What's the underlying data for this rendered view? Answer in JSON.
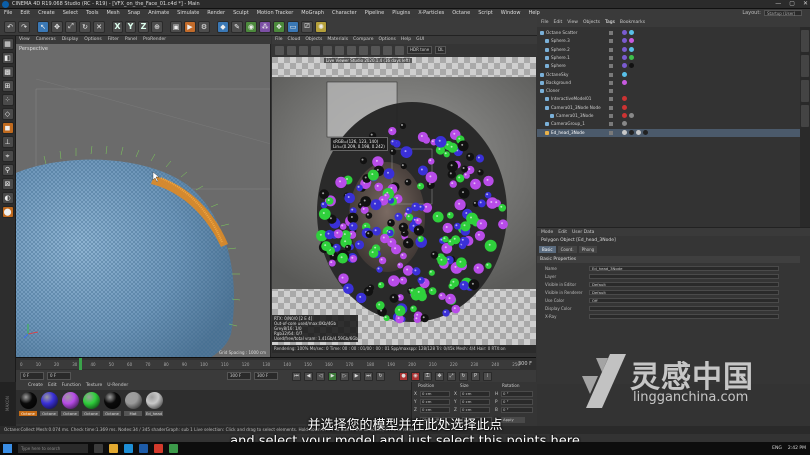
{
  "window": {
    "title": "CINEMA 4D R19.068 Studio (RC - R19) - [VFX_on_the_Face_01.c4d *] - Main",
    "controls": [
      "—",
      "▢",
      "✕"
    ]
  },
  "menubar": [
    "File",
    "Edit",
    "Create",
    "Select",
    "Tools",
    "Mesh",
    "Snap",
    "Animate",
    "Simulate",
    "Render",
    "Sculpt",
    "Motion Tracker",
    "MoGraph",
    "Character",
    "Pipeline",
    "Plugins",
    "X-Particles",
    "Octane",
    "Script",
    "Window",
    "Help"
  ],
  "layout": {
    "label": "Layout:",
    "value": "Startup (User)"
  },
  "toolbar": {
    "axis_labels": [
      "X",
      "Y",
      "Z"
    ]
  },
  "viewport": {
    "menu": [
      "View",
      "Cameras",
      "Display",
      "Options",
      "Filter",
      "Panel",
      "ProRender"
    ],
    "label": "Perspective",
    "grid_spacing": "Grid Spacing : 1000 cm"
  },
  "render_window": {
    "menu": [
      "File",
      "Cloud",
      "Objects",
      "Materials",
      "Compare",
      "Options",
      "Help",
      "GUI"
    ],
    "title": "Live Viewer Studio 2020.1.4 (16 days left)",
    "tonemap": "HDR tone",
    "zoom": "DL",
    "pixel_info": [
      "sRGB=(126, 123, 140)",
      "Lin=(0.209, 0.198, 0.242)"
    ],
    "stats": [
      "RTX: 0/N0/0 [2 E 4]",
      "Out-of-core used/max:0Kb/4Gb",
      "Grey8/16: 1/0",
      "Rgb32/64: 0/7",
      "Used/free/total vram: 1.41Gb/4.59Gb/6Gb"
    ],
    "status": "Rendering: 100%   Ms/sec: 0   Time: 00 : 00 : 01/00 : 00 : 01   Spp/maxspp: 128/128   Tri: 0/45k   Mesh: 4/4   Hair: 0   RTX:on"
  },
  "object_manager": {
    "menu": [
      "File",
      "Edit",
      "View",
      "Objects",
      "Tags",
      "Bookmarks"
    ],
    "selected_menu": "Tags",
    "rows": [
      {
        "name": "Octane Scatter",
        "indent": 0,
        "selected": false,
        "tags": [
          "#7a5bd0",
          "#58c0e8"
        ]
      },
      {
        "name": "Sphere.3",
        "indent": 1,
        "selected": false,
        "tags": [
          "#7a5bd0",
          "#c85ae0"
        ]
      },
      {
        "name": "Sphere.2",
        "indent": 1,
        "selected": false,
        "tags": [
          "#7a5bd0",
          "#58c0e8"
        ]
      },
      {
        "name": "Sphere.1",
        "indent": 1,
        "selected": false,
        "tags": [
          "#7a5bd0",
          "#3ec04a"
        ]
      },
      {
        "name": "Sphere",
        "indent": 1,
        "selected": false,
        "tags": [
          "#7a5bd0",
          "#111111"
        ]
      },
      {
        "name": "OctaneSky",
        "indent": 0,
        "selected": false,
        "tags": [
          "#58c0e8"
        ]
      },
      {
        "name": "Background",
        "indent": 0,
        "selected": false,
        "tags": [
          "#c85ae0"
        ]
      },
      {
        "name": "Cloner",
        "indent": 0,
        "selected": false,
        "tags": []
      },
      {
        "name": "InteractiveModel01",
        "indent": 1,
        "selected": false,
        "tags": [
          "#cc3333"
        ]
      },
      {
        "name": "Camera01_3Node Node",
        "indent": 1,
        "selected": false,
        "tags": [
          "#cc3333"
        ]
      },
      {
        "name": "Camera01_3Node",
        "indent": 2,
        "selected": false,
        "tags": [
          "#cc3333",
          "#888888"
        ]
      },
      {
        "name": "CameraGroup_1",
        "indent": 1,
        "selected": false,
        "tags": [
          "#888888"
        ]
      },
      {
        "name": "Ed_head_3Node",
        "indent": 1,
        "selected": true,
        "tags": [
          "#c8c8c8",
          "#222222",
          "#c8c8c8",
          "#222222"
        ]
      }
    ]
  },
  "attribute_manager": {
    "menu": [
      "Mode",
      "Edit",
      "User Data"
    ],
    "title": "Polygon Object [Ed_head_3Node]",
    "tabs": [
      "Basic",
      "Coord.",
      "Phong"
    ],
    "selected_tab": "Basic",
    "section": "Basic Properties",
    "fields": [
      {
        "label": "Name",
        "value": "Ed_head_3Node"
      },
      {
        "label": "Layer",
        "value": ""
      },
      {
        "label": "Visible in Editor",
        "value": "Default"
      },
      {
        "label": "Visible in Renderer",
        "value": "Default"
      },
      {
        "label": "Use Color",
        "value": "Off"
      },
      {
        "label": "Display Color",
        "value": ""
      },
      {
        "label": "X-Ray",
        "value": ""
      }
    ]
  },
  "timeline": {
    "ticks": [
      "0",
      "10",
      "20",
      "30",
      "40",
      "50",
      "60",
      "70",
      "80",
      "90",
      "100",
      "110",
      "120",
      "130",
      "140",
      "150",
      "160",
      "170",
      "180",
      "190",
      "200",
      "210",
      "220",
      "230",
      "240",
      "250"
    ],
    "frame_end": "300 F"
  },
  "transport": {
    "start": "0 F",
    "current": "0 F",
    "end": "300 F",
    "end2": "300 F"
  },
  "material_manager": {
    "menu": [
      "Create",
      "Edit",
      "Function",
      "Texture",
      "U-Render"
    ],
    "materials": [
      {
        "label": "Octane",
        "color": "#0a0a0a",
        "active": true
      },
      {
        "label": "Octane",
        "color": "#3a30d8",
        "active": false
      },
      {
        "label": "Octane",
        "color": "#b84ce8",
        "active": false
      },
      {
        "label": "Octane",
        "color": "#2fd03c",
        "active": false
      },
      {
        "label": "Octane",
        "color": "#0a0a0a",
        "active": false
      },
      {
        "label": "Mat",
        "color": "#9a9a9a",
        "active": false
      },
      {
        "label": "Ed_head",
        "color": "#c9c9c9",
        "active": false
      }
    ]
  },
  "coordinates": {
    "headers": [
      "Position",
      "Size",
      "Rotation"
    ],
    "rows": [
      {
        "axis": "X",
        "pos": "0 cm",
        "size": "0 cm",
        "rot_label": "H",
        "rot": "0 °"
      },
      {
        "axis": "Y",
        "pos": "0 cm",
        "size": "0 cm",
        "rot_label": "P",
        "rot": "0 °"
      },
      {
        "axis": "Z",
        "pos": "0 cm",
        "size": "0 cm",
        "rot_label": "B",
        "rot": "0 °"
      }
    ],
    "mode": "Object (Rel)",
    "size_mode": "Size",
    "apply": "Apply"
  },
  "statusbar": "Octane:Collect Mesh:0.074 ms.   Check time:1.369 ms.   Nodes:34 / 345   shaderGraph: sub 1   Live selection: Click and drag to select elements. Hold down SHIFT to add to the selection, CTRL to remove.",
  "subtitles": {
    "cn": "并选择您的模型并在此处选择此点",
    "en": "and select your model and just select this points here"
  },
  "watermark": {
    "cn": "灵感中国",
    "en": "lingganchina.com"
  },
  "taskbar": {
    "search": "Type here to search",
    "lang": "ENG",
    "time": "2:42 PM"
  },
  "colors": {
    "accent": "#3a78b5",
    "selected_row": "#4b5a6b",
    "octane_orange": "#c46a14",
    "timeline_cursor": "#3aa24a"
  }
}
